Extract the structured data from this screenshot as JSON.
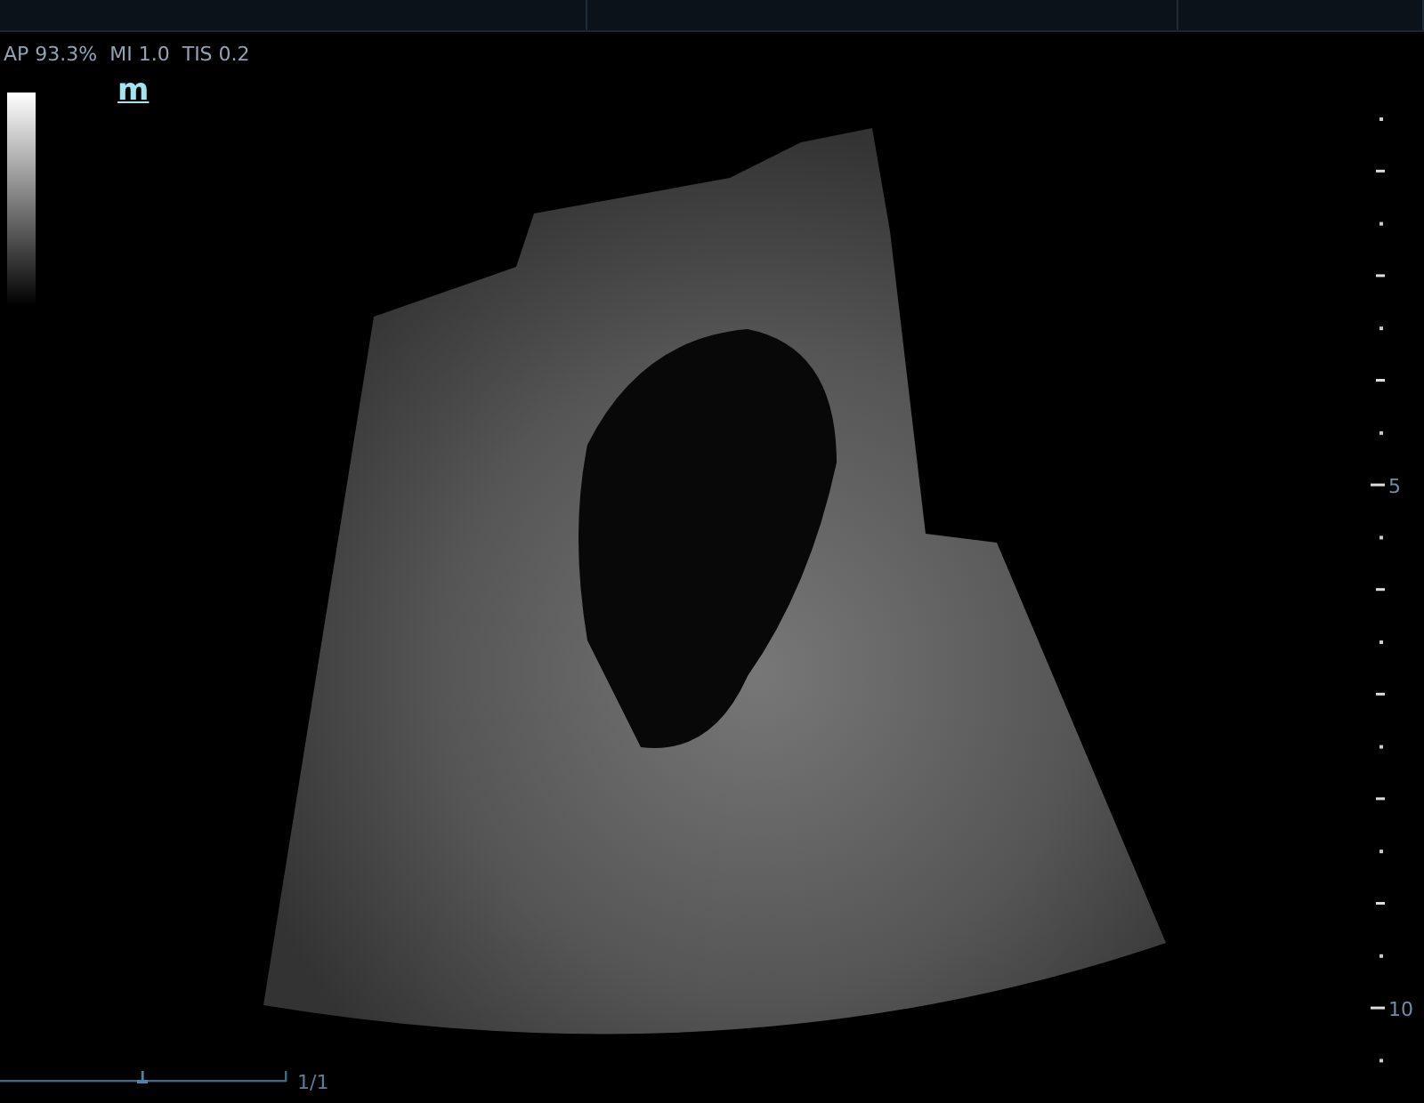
{
  "readouts": [
    "AP 93.3%",
    "MI 1.0",
    "TIS 0.2"
  ],
  "mode_glyph": "m",
  "depth_scale": {
    "labels": [
      "5",
      "10"
    ]
  },
  "cine": {
    "frame_counter": "1/1"
  }
}
